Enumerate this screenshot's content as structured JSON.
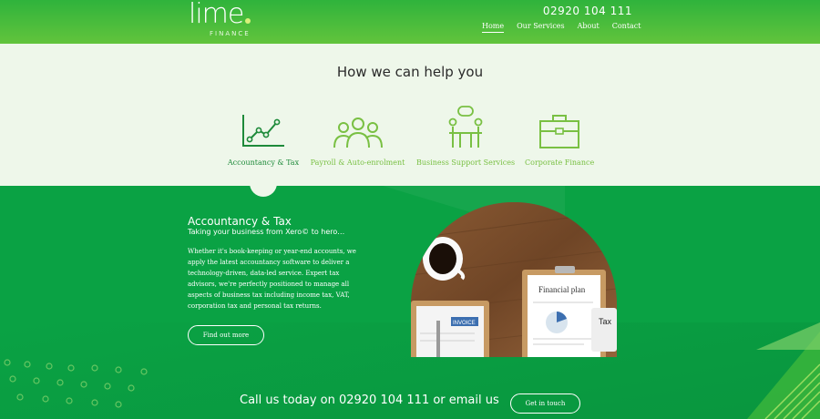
{
  "header": {
    "logo_main": "lime",
    "logo_sub": "FINANCE",
    "phone": "02920 104 111",
    "nav": [
      "Home",
      "Our Services",
      "About",
      "Contact"
    ]
  },
  "services": {
    "title": "How we can help you",
    "items": [
      {
        "label": "Accountancy & Tax",
        "icon": "chart-line-icon"
      },
      {
        "label": "Payroll & Auto-enrolment",
        "icon": "people-group-icon"
      },
      {
        "label": "Business Support Services",
        "icon": "meeting-icon"
      },
      {
        "label": "Corporate Finance",
        "icon": "briefcase-icon"
      }
    ]
  },
  "section": {
    "title": "Accountancy & Tax",
    "subtitle": "Taking your business from Xero© to hero…",
    "body": "Whether it's book-keeping or year-end accounts, we apply the latest accountancy software to deliver a technology-driven, data-led service. Expert tax advisors, we're perfectly positioned to manage all aspects of business tax including income tax, VAT, corporation tax and personal tax returns.",
    "button": "Find out more",
    "photo": {
      "plan_title": "Financial plan",
      "invoice": "INVOICE",
      "tax": "Tax"
    }
  },
  "cta": {
    "text": "Call us today on 02920 104 111 or email us",
    "button": "Get in touch"
  },
  "colors": {
    "header_green": "#3fb93c",
    "lime_accent": "#79c043",
    "dark_green": "#1e8a3a",
    "section_green": "#0aa244",
    "services_bg": "#eef7ea"
  }
}
